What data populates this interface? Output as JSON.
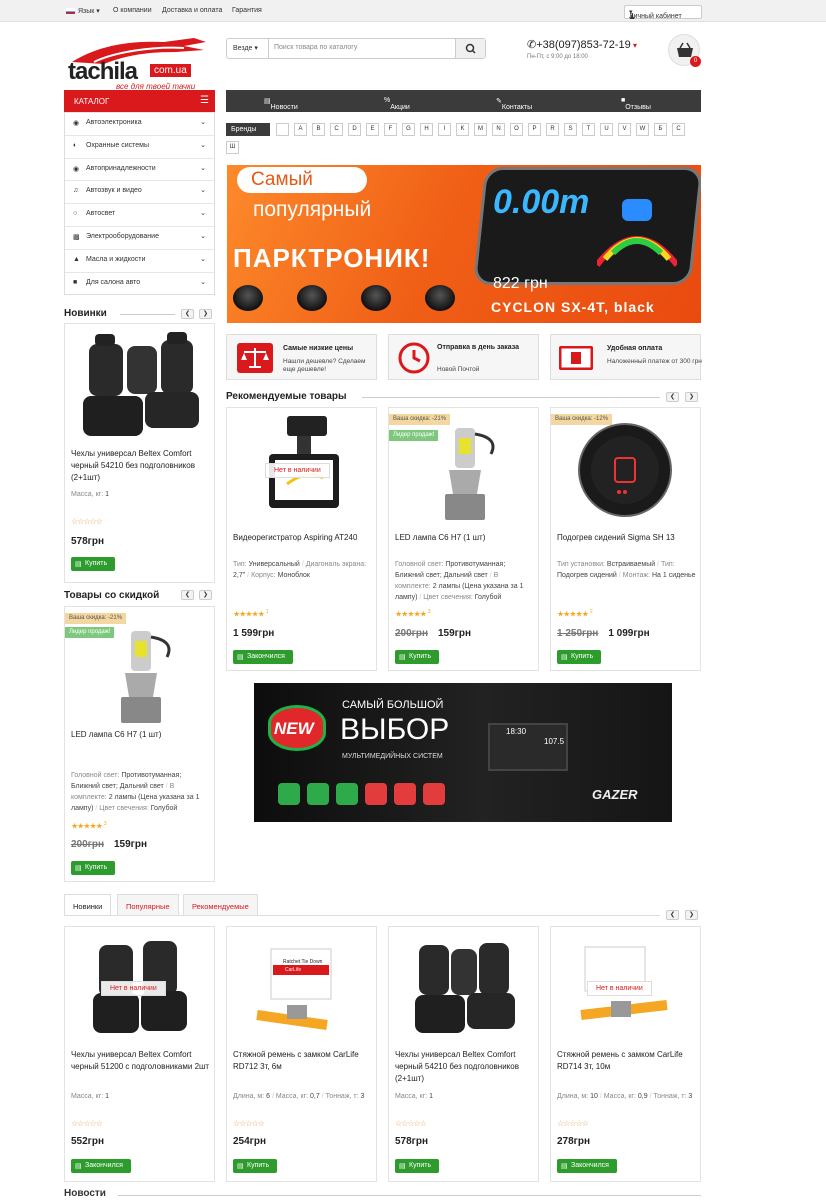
{
  "topbar": {
    "language": "Язык",
    "links": [
      "О компании",
      "Доставка и оплата",
      "Гарантия"
    ],
    "account": "Личный кабинет"
  },
  "logo": {
    "name": "tachila",
    "domain": "com.ua",
    "slogan": "все для твоей тачки"
  },
  "search": {
    "scope": "Везде",
    "placeholder": "Поиск товара по каталогу"
  },
  "contact": {
    "phone": "+38(097)853-72-19",
    "hours": "Пн-Пт, с 9:00 до 18:00"
  },
  "cart": {
    "count": "0"
  },
  "catalog": {
    "title": "КАТАЛОГ",
    "items": [
      "Автоэлектроника",
      "Охранные системы",
      "Автопринадлежности",
      "Автозвук и видео",
      "Автосвет",
      "Электрооборудование",
      "Масла и жидкости",
      "Для салона авто"
    ]
  },
  "nav": [
    "Новости",
    "Акции",
    "Контакты",
    "Отзывы"
  ],
  "brands": {
    "label": "Бренды",
    "letters": [
      "",
      "A",
      "B",
      "C",
      "D",
      "E",
      "F",
      "G",
      "H",
      "I",
      "K",
      "M",
      "N",
      "O",
      "P",
      "R",
      "S",
      "T",
      "U",
      "V",
      "W",
      "Б",
      "С",
      "Ш"
    ]
  },
  "banner": {
    "line1": "Самый",
    "line2": "популярный",
    "headline": "ПАРКТРОНИК!",
    "display": "0.00m",
    "price": "822 грн",
    "model": "CYCLON SX-4T, black"
  },
  "features": [
    {
      "title": "Самые низкие цены",
      "sub": "Нашли дешевле? Сделаем еще дешевле!"
    },
    {
      "title": "Отправка в день заказа",
      "sub": "Новой Почтой"
    },
    {
      "title": "Удобная оплата",
      "sub": "Наложенный платеж от 300 грн"
    }
  ],
  "sidebar_new": {
    "heading": "Новинки",
    "name": "Чехлы универсал Beltex Comfort черный 54210 без подголовников (2+1шт)",
    "spec_label": "Масса, кг:",
    "spec_value": "1",
    "price": "578грн",
    "button": "Купить",
    "rating": 0
  },
  "sidebar_sale": {
    "heading": "Товары со скидкой",
    "discount": "Ваша скидка: -21%",
    "leader": "Лидер продаж!",
    "name": "LED лампа C6 H7 (1 шт)",
    "specs": [
      [
        "Головной свет:",
        "Противотуманная; Ближний свет; Дальний свет"
      ],
      [
        "В комплекте:",
        "2 лампы (Цена указана за 1 лампу)"
      ],
      [
        "Цвет свечения:",
        "Голубой"
      ]
    ],
    "old_price": "200грн",
    "price": "159грн",
    "button": "Купить",
    "rating": 5,
    "reviews": "3"
  },
  "recommended": {
    "heading": "Рекомендуемые товары",
    "items": [
      {
        "name": "Видеорегистратор Aspiring AT240",
        "badge": "Нет в наличии",
        "specs": [
          [
            "Тип:",
            "Универсальный"
          ],
          [
            "Диагональ экрана:",
            "2,7\""
          ],
          [
            "Корпус:",
            "Моноблок"
          ]
        ],
        "price": "1 599грн",
        "button": "Закончился",
        "rating": 5,
        "reviews": "1"
      },
      {
        "name": "LED лампа C6 H7 (1 шт)",
        "discount": "Ваша скидка: -21%",
        "leader": "Лидер продаж!",
        "specs": [
          [
            "Головной свет:",
            "Противотуманная; Ближний свет; Дальний свет"
          ],
          [
            "В комплекте:",
            "2 лампы (Цена указана за 1 лампу)"
          ],
          [
            "Цвет свечения:",
            "Голубой"
          ]
        ],
        "old_price": "200грн",
        "price": "159грн",
        "button": "Купить",
        "rating": 5,
        "reviews": "3"
      },
      {
        "name": "Подогрев сидений Sigma SH 13",
        "discount": "Ваша скидка: -12%",
        "specs": [
          [
            "Тип установки:",
            "Встраиваемый"
          ],
          [
            "Тип:",
            "Подогрев сидений"
          ],
          [
            "Монтаж:",
            "На 1 сиденье"
          ]
        ],
        "old_price": "1 250грн",
        "price": "1 099грн",
        "button": "Купить",
        "rating": 5,
        "reviews": "2"
      }
    ]
  },
  "promo": {
    "badge": "NEW",
    "line1": "САМЫЙ БОЛЬШОЙ",
    "line2": "ВЫБОР",
    "line3": "МУЛЬТИМЕДИЙНЫХ СИСТЕМ",
    "brand": "GAZER",
    "screen1": "18:30",
    "screen2": "107.5"
  },
  "tabs": [
    "Новинки",
    "Популярные",
    "Рекомендуемые"
  ],
  "tab_products": [
    {
      "name": "Чехлы универсал Beltex Comfort черный 51200 с подголовниками 2шт",
      "badge": "Нет в наличии",
      "specs": [
        [
          "Масса, кг:",
          "1"
        ]
      ],
      "price": "552грн",
      "button": "Закончился"
    },
    {
      "name": "Стяжной ремень с замком CarLife RD712 3т, 6м",
      "specs": [
        [
          "Длина, м:",
          "6"
        ],
        [
          "Масса, кг:",
          "0,7"
        ],
        [
          "Тоннаж, т:",
          "3"
        ]
      ],
      "price": "254грн",
      "button": "Купить",
      "label1": "Ratchet Tie Down",
      "label2": "CarLife"
    },
    {
      "name": "Чехлы универсал Beltex Comfort черный 54210 без подголовников (2+1шт)",
      "specs": [
        [
          "Масса, кг:",
          "1"
        ]
      ],
      "price": "578грн",
      "button": "Купить"
    },
    {
      "name": "Стяжной ремень с замком CarLife RD714 3т, 10м",
      "badge": "Нет в наличии",
      "specs": [
        [
          "Длина, м:",
          "10"
        ],
        [
          "Масса, кг:",
          "0,9"
        ],
        [
          "Тоннаж, т:",
          "3"
        ]
      ],
      "price": "278грн",
      "button": "Закончился"
    }
  ],
  "news_heading": "Новости",
  "colors": {
    "accent": "#d9191c",
    "buy": "#2d9c2d",
    "nav": "#3b3b3b",
    "star": "#f5a623"
  }
}
